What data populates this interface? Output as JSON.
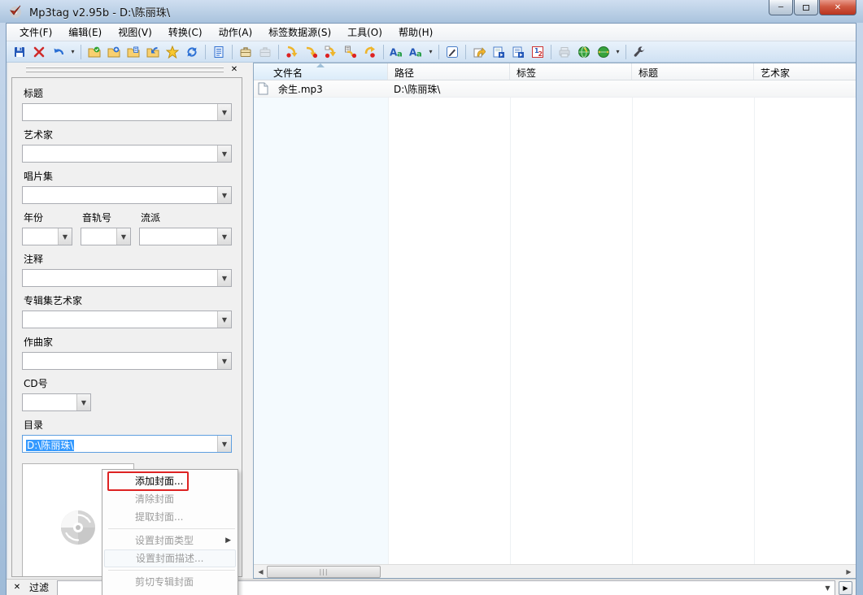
{
  "window": {
    "title": "Mp3tag v2.95b  -  D:\\陈丽珠\\",
    "controls": {
      "minimize": "minimize",
      "maximize": "maximize",
      "close": "close"
    }
  },
  "menu_bar": {
    "items": [
      {
        "label": "文件(F)"
      },
      {
        "label": "编辑(E)"
      },
      {
        "label": "视图(V)"
      },
      {
        "label": "转换(C)"
      },
      {
        "label": "动作(A)"
      },
      {
        "label": "标签数据源(S)"
      },
      {
        "label": "工具(O)"
      },
      {
        "label": "帮助(H)"
      }
    ]
  },
  "toolbar": {
    "icons": [
      "save-icon",
      "remove-tag-icon",
      "undo-icon",
      "undo-dropdown",
      "folder-ok-icon",
      "folder-add-icon",
      "folder-playlist-icon",
      "change-directory-icon",
      "favorites-icon",
      "refresh-icon",
      "extended-tags-icon",
      "tag-copy-case-icon",
      "tag-paste-case-icon",
      "tag-cut-icon",
      "tag-copy-icon",
      "tag-paste-icon",
      "tag-paste-merge-icon",
      "tag-remove-icon",
      "convert-tag-filename-icon",
      "convert-filename-tag-icon",
      "convert-dropdown",
      "edit-tag-icon",
      "actions-icon",
      "play-icon",
      "playlist-icon",
      "autonumber-icon",
      "print-icon",
      "websource-icon",
      "websource-menu-icon",
      "websource-dropdown",
      "options-icon"
    ]
  },
  "tag_panel": {
    "fields": [
      {
        "label": "标题",
        "value": ""
      },
      {
        "label": "艺术家",
        "value": ""
      },
      {
        "label": "唱片集",
        "value": ""
      },
      {
        "label": "年份",
        "value": ""
      },
      {
        "label": "音轨号",
        "value": ""
      },
      {
        "label": "流派",
        "value": ""
      },
      {
        "label": "注释",
        "value": ""
      },
      {
        "label": "专辑集艺术家",
        "value": ""
      },
      {
        "label": "作曲家",
        "value": ""
      },
      {
        "label": "CD号",
        "value": ""
      },
      {
        "label": "目录",
        "value": "D:\\陈丽珠\\"
      }
    ],
    "album_art": "disc-placeholder-icon"
  },
  "context_menu": {
    "items": [
      {
        "label": "添加封面...",
        "enabled": true,
        "annotated": true
      },
      {
        "label": "清除封面",
        "enabled": false
      },
      {
        "label": "提取封面...",
        "enabled": false
      },
      {
        "label": "设置封面类型",
        "enabled": false,
        "submenu": true
      },
      {
        "label": "设置封面描述...",
        "enabled": false
      },
      {
        "label": "剪切专辑封面",
        "enabled": false
      }
    ]
  },
  "file_list": {
    "columns": [
      "文件名",
      "路径",
      "标签",
      "标题",
      "艺术家"
    ],
    "sort_column": "文件名",
    "sort_direction": "ascending",
    "rows": [
      {
        "filename": "余生.mp3",
        "path": "D:\\陈丽珠\\",
        "tag": "",
        "title": "",
        "artist": ""
      }
    ]
  },
  "filter": {
    "label": "过滤",
    "value": ""
  },
  "colors": {
    "selection_blue": "#3399ff",
    "annotation_red": "#dd2222",
    "close_button_red": "#b93420",
    "toolbar_blue": "#cfe1f3"
  }
}
